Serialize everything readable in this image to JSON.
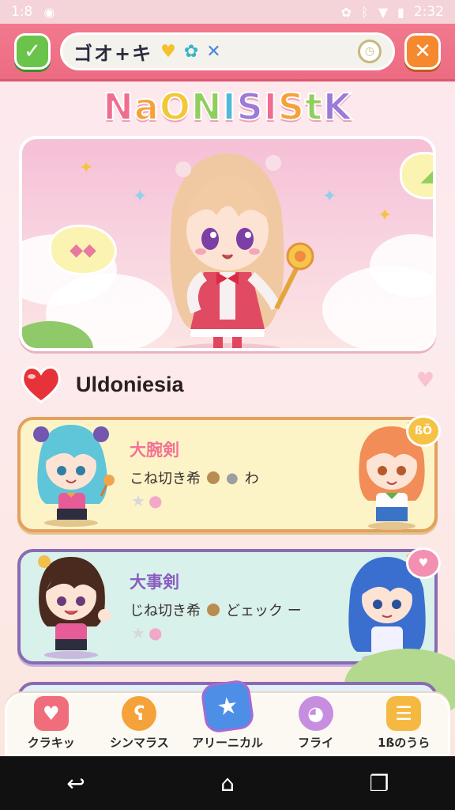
{
  "status_bar": {
    "left_text": "1:8",
    "time": "2:32"
  },
  "top_bar": {
    "search_text": "ゴオ+キ",
    "chips": [
      "heart",
      "cat",
      "cross"
    ]
  },
  "logo": {
    "letters": [
      "N",
      "a",
      "O",
      "N",
      "I",
      "S",
      "I",
      "S",
      "t",
      "K"
    ],
    "colors": [
      "#f06d8f",
      "#f5a23b",
      "#f2c83a",
      "#8fcf5d",
      "#4fb9d9",
      "#9b7ad8",
      "#f06d8f",
      "#f5a23b",
      "#8fcf5d",
      "#9b7ad8"
    ]
  },
  "hero": {
    "left_badge_text": "◆◆",
    "right_badge_text": "◢"
  },
  "section": {
    "title": "Uldoniesia"
  },
  "cards": [
    {
      "title": "大腕剣",
      "subtitle": "こね切き希",
      "sub_tail": "わ",
      "badge": "ßÖ"
    },
    {
      "title": "大事剣",
      "subtitle": "じね切き希",
      "sub_tail": "どェック ー",
      "badge": "♥"
    }
  ],
  "tabs": [
    {
      "label": "クラキッ",
      "icon": "gift-icon",
      "color": "#f06d7c"
    },
    {
      "label": "シンマラス",
      "icon": "bear-icon",
      "color": "#f5a23b"
    },
    {
      "label": "アリーニカル",
      "icon": "star-icon",
      "color": "#4d8ee6"
    },
    {
      "label": "フライ",
      "icon": "pig-icon",
      "color": "#c78ee0"
    },
    {
      "label": "1ßのうら",
      "icon": "list-icon",
      "color": "#f5b942"
    }
  ],
  "colors": {
    "accent": "#ee6f86",
    "card1_border": "#e3a05f",
    "card2_border": "#8a6bb2"
  }
}
